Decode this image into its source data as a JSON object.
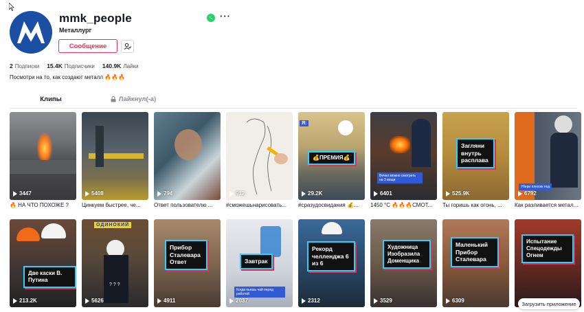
{
  "profile": {
    "username": "mmk_people",
    "nickname": "Металлург",
    "message_button": "Сообщение",
    "bio": "Посмотри на то, как создают металл 🔥🔥🔥",
    "stats": {
      "following_count": "2",
      "following_label": "Подписки",
      "followers_count": "15.4K",
      "followers_label": "Подписчики",
      "likes_count": "140.9K",
      "likes_label": "Лайки"
    },
    "avatar_color": "#1a4fa3"
  },
  "tabs": {
    "clips": "Клипы",
    "liked": "Лайкнул(-а)"
  },
  "videos": [
    {
      "views": "3447",
      "caption": "🔥 НА ЧТО ПОХОЖЕ ?"
    },
    {
      "views": "5408",
      "caption": "Цинкуем быстрее, че..."
    },
    {
      "views": "794",
      "caption": "Ответ пользователю ..."
    },
    {
      "views": "912",
      "caption": "#сможешьнарисовать..."
    },
    {
      "views": "29.2K",
      "caption": "#сразудосвидания 💰...",
      "overlay_top": "Я:",
      "overlay": "💰ПРЕМИЯ💰"
    },
    {
      "views": "6401",
      "caption": "1450 °С 🔥🔥🔥СМОТ...",
      "small_tag": "Вечно можно смотреть на 3 вещи"
    },
    {
      "views": "525.9K",
      "caption": "Ты горишь как огонь, ...",
      "overlay": "Загляни внутрь расплава"
    },
    {
      "views": "6792",
      "caption": "Как разливается метал...",
      "small_tag": "Убери плюсик под"
    },
    {
      "views": "213.2K",
      "caption": "",
      "overlay": "Две каски В. Путина"
    },
    {
      "views": "5626",
      "caption": "",
      "overlay_top": "ОДИНОКИЙ"
    },
    {
      "views": "4911",
      "caption": "",
      "overlay": "Прибор Сталевара Ответ"
    },
    {
      "views": "2037",
      "caption": "",
      "overlay": "Завтрак",
      "small_tag": "Когда пьешь чай перед работой"
    },
    {
      "views": "2312",
      "caption": "",
      "overlay": "Рекорд челленджа 6 из 6"
    },
    {
      "views": "3529",
      "caption": "",
      "overlay": "Художница Изобразила Доменщика"
    },
    {
      "views": "6309",
      "caption": "",
      "overlay": "Маленький Прибор Сталевара"
    },
    {
      "views": "",
      "caption": "",
      "overlay": "Испытание Спецодежды Огнем"
    }
  ],
  "download_app": "Загрузить приложение",
  "colors": {
    "accent": "#fe2c55",
    "cyan": "#2ad1ff"
  }
}
